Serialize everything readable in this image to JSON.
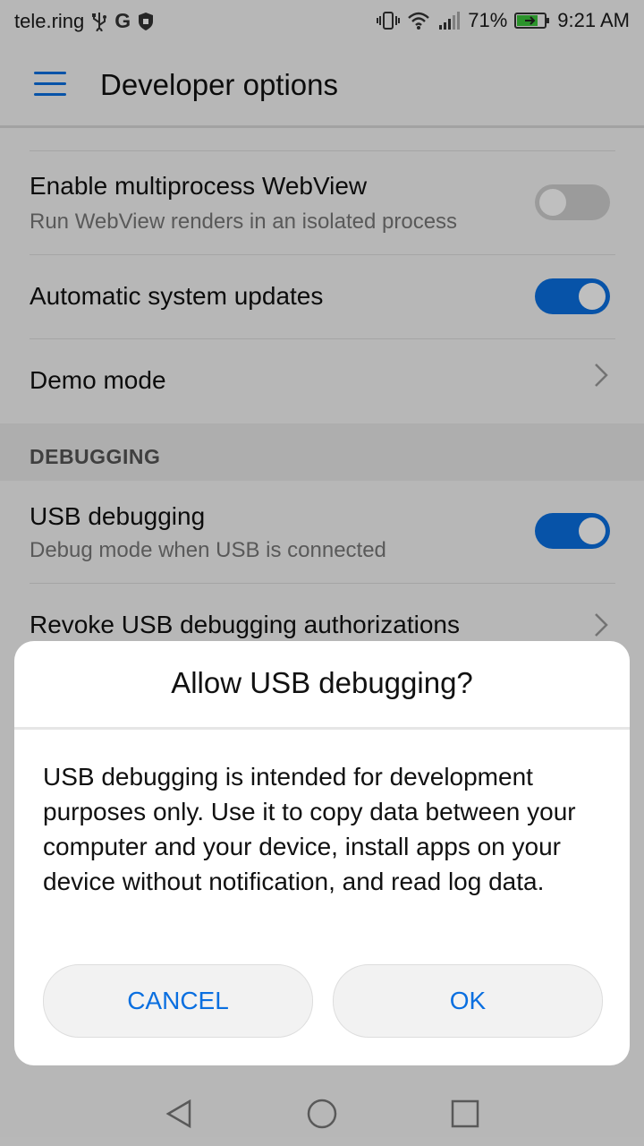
{
  "status_bar": {
    "carrier": "tele.ring",
    "battery": "71%",
    "time": "9:21 AM",
    "icons": [
      "usb-icon",
      "google-icon",
      "shield-icon",
      "vibrate-icon",
      "wifi-icon",
      "signal-icon",
      "battery-charging-icon"
    ]
  },
  "app_bar": {
    "title": "Developer options"
  },
  "settings": {
    "multiprocess": {
      "title": "Enable multiprocess WebView",
      "subtitle": "Run WebView renders in an isolated process",
      "enabled": false
    },
    "auto_updates": {
      "title": "Automatic system updates",
      "enabled": true
    },
    "demo_mode": {
      "title": "Demo mode"
    },
    "section_debugging": "DEBUGGING",
    "usb_debugging": {
      "title": "USB debugging",
      "subtitle": "Debug mode when USB is connected",
      "enabled": true
    },
    "revoke": {
      "title": "Revoke USB debugging authorizations"
    }
  },
  "dialog": {
    "title": "Allow USB debugging?",
    "body": "USB debugging is intended for development purposes only. Use it to copy data between your computer and your device, install apps on your device without notification, and read log data.",
    "cancel_label": "CANCEL",
    "ok_label": "OK"
  },
  "colors": {
    "accent": "#0a6fe0",
    "toggle_off": "#cfcfcf"
  }
}
